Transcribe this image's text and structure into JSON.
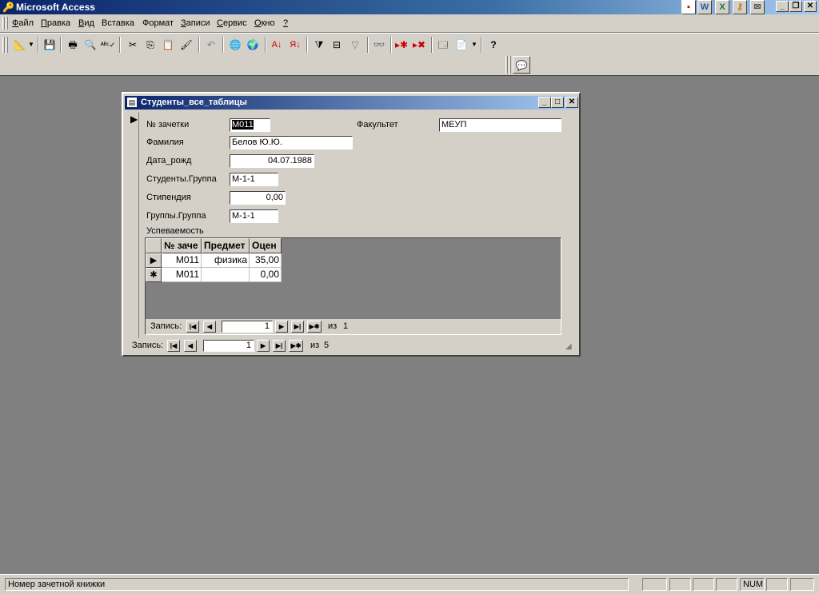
{
  "app": {
    "title": "Microsoft Access"
  },
  "menu": [
    {
      "label": "Файл",
      "u": "Ф",
      "rest": "айл"
    },
    {
      "label": "Правка",
      "u": "П",
      "rest": "равка"
    },
    {
      "label": "Вид",
      "u": "В",
      "rest": "ид"
    },
    {
      "label": "Вставка",
      "u": "",
      "rest": "Вставка"
    },
    {
      "label": "Формат",
      "u": "",
      "rest": "Формат"
    },
    {
      "label": "Записи",
      "u": "З",
      "rest": "аписи"
    },
    {
      "label": "Сервис",
      "u": "С",
      "rest": "ервис"
    },
    {
      "label": "Окно",
      "u": "О",
      "rest": "кно"
    },
    {
      "label": "?",
      "u": "?",
      "rest": ""
    }
  ],
  "form": {
    "title": "Студенты_все_таблицы",
    "fields": {
      "zachetka_label": "№ зачетки",
      "zachetka_value": "М011",
      "familia_label": "Фамилия",
      "familia_value": "Белов Ю.Ю.",
      "data_label": "Дата_рожд",
      "data_value": "04.07.1988",
      "gruppa_label": "Студенты.Группа",
      "gruppa_value": "М-1-1",
      "stipendia_label": "Стипендия",
      "stipendia_value": "0,00",
      "gruppy_label": "Группы.Группа",
      "gruppy_value": "М-1-1",
      "fakultet_label": "Факультет",
      "fakultet_value": "МЕУП"
    },
    "subform": {
      "label": "Успеваемость",
      "columns": [
        "№ заче",
        "Предмет",
        "Оцен"
      ],
      "rows": [
        {
          "selector": "▶",
          "cells": [
            "М011",
            "физика",
            "35,00"
          ]
        },
        {
          "selector": "✱",
          "cells": [
            "М011",
            "",
            "0,00"
          ]
        }
      ],
      "nav": {
        "label": "Запись:",
        "current": "1",
        "of": "из",
        "total": "1"
      }
    },
    "nav": {
      "label": "Запись:",
      "current": "1",
      "of": "из",
      "total": "5"
    }
  },
  "status": {
    "text": "Номер зачетной книжки",
    "num": "NUM"
  }
}
